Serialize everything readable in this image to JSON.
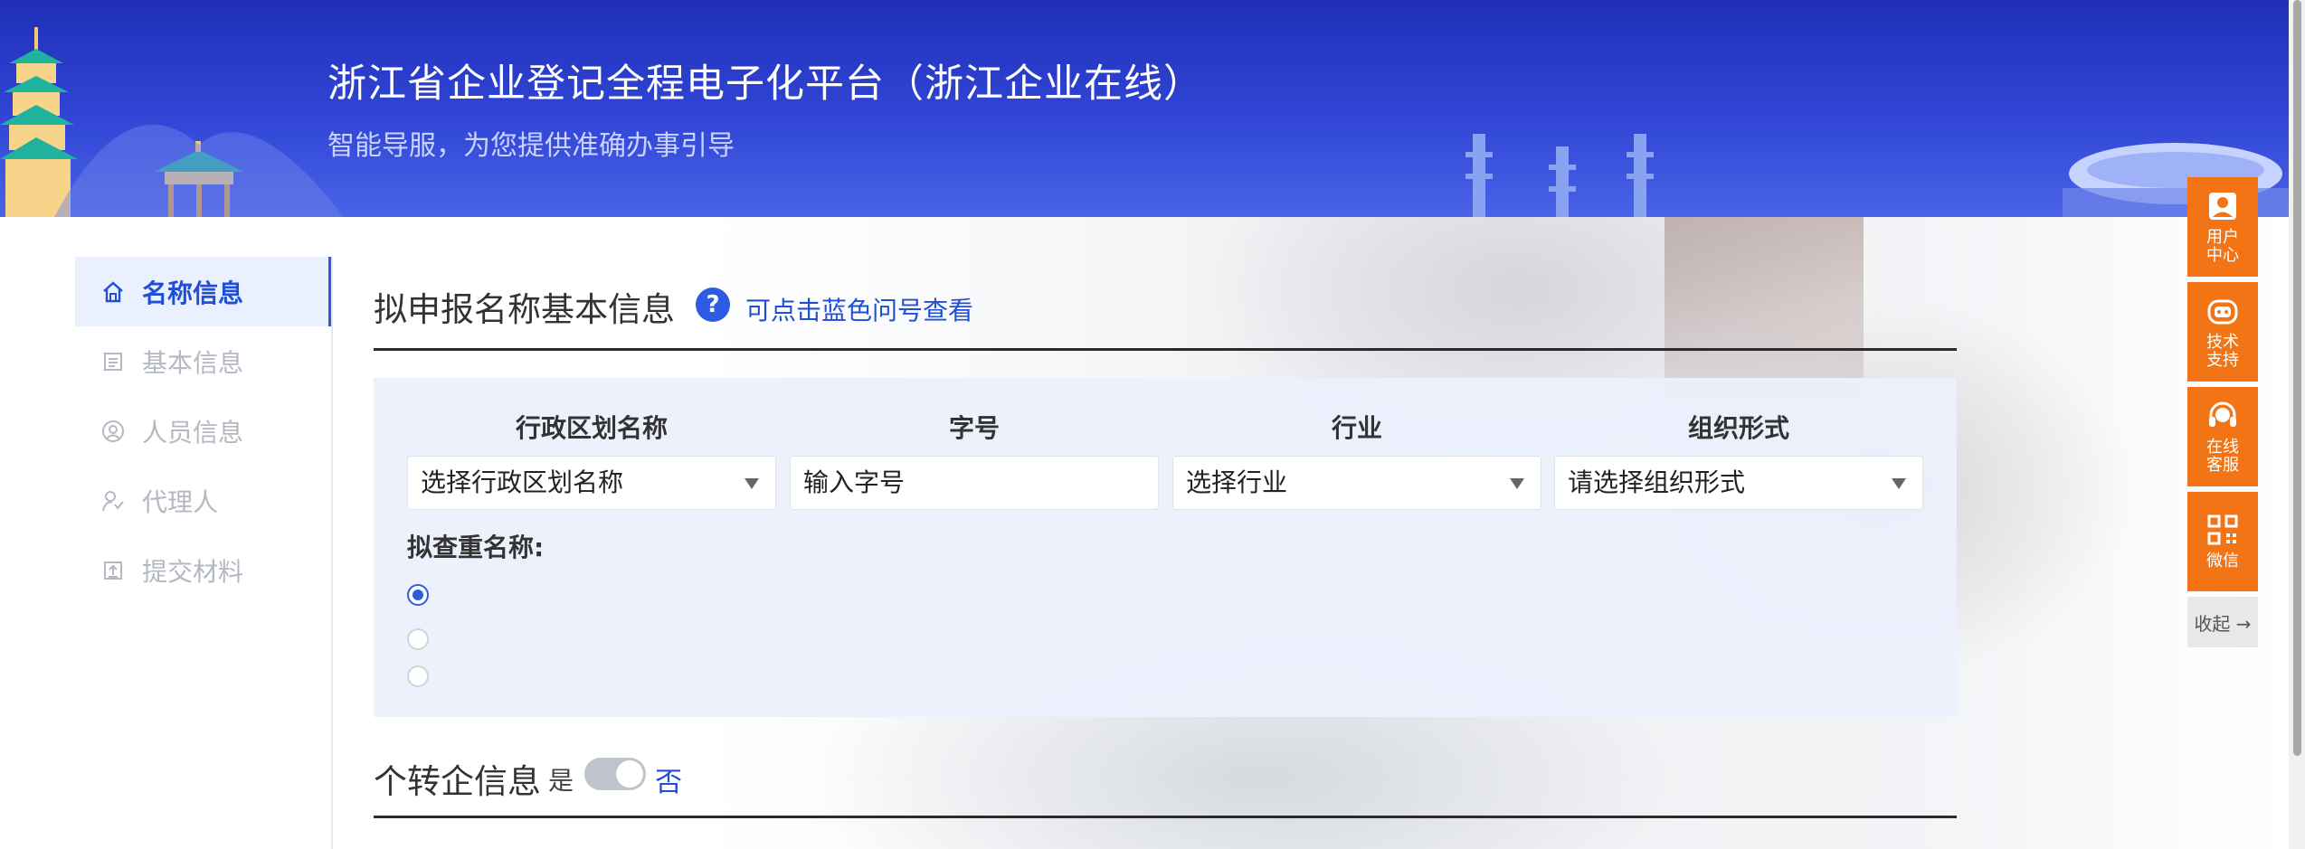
{
  "header": {
    "title": "浙江省企业登记全程电子化平台（浙江企业在线）",
    "subtitle": "智能导服，为您提供准确办事引导"
  },
  "sidebar": {
    "items": [
      {
        "label": "名称信息",
        "icon": "home-icon",
        "active": true
      },
      {
        "label": "基本信息",
        "icon": "document-icon",
        "active": false
      },
      {
        "label": "人员信息",
        "icon": "user-circle-icon",
        "active": false
      },
      {
        "label": "代理人",
        "icon": "agent-icon",
        "active": false
      },
      {
        "label": "提交材料",
        "icon": "upload-icon",
        "active": false
      }
    ]
  },
  "main": {
    "section_title": "拟申报名称基本信息",
    "help_icon": "?",
    "help_text": "可点击蓝色问号查看",
    "columns": [
      {
        "label": "行政区划名称",
        "value": "选择行政区划名称",
        "type": "select"
      },
      {
        "label": "字号",
        "value": "输入字号",
        "type": "input"
      },
      {
        "label": "行业",
        "value": "选择行业",
        "type": "select"
      },
      {
        "label": "组织形式",
        "value": "请选择组织形式",
        "type": "select"
      }
    ],
    "duplicate_label": "拟查重名称:",
    "radio_options": [
      {
        "checked": true
      },
      {
        "checked": false
      },
      {
        "checked": false
      }
    ],
    "section2_title": "个转企信息",
    "toggle_yes": "是",
    "toggle_no": "否",
    "toggle_state": "否"
  },
  "floatbar": {
    "items": [
      {
        "label": "用户中心",
        "icon": "user-card-icon"
      },
      {
        "label": "技术支持",
        "icon": "robot-icon"
      },
      {
        "label": "在线客服",
        "icon": "headset-icon"
      },
      {
        "label": "微信",
        "icon": "qrcode-icon"
      }
    ],
    "collapse_label": "收起 →"
  },
  "colors": {
    "header_blue": "#3146d6",
    "accent_blue": "#2d5be3",
    "float_orange": "#f27414",
    "panel_bg": "#ebf0fc"
  }
}
